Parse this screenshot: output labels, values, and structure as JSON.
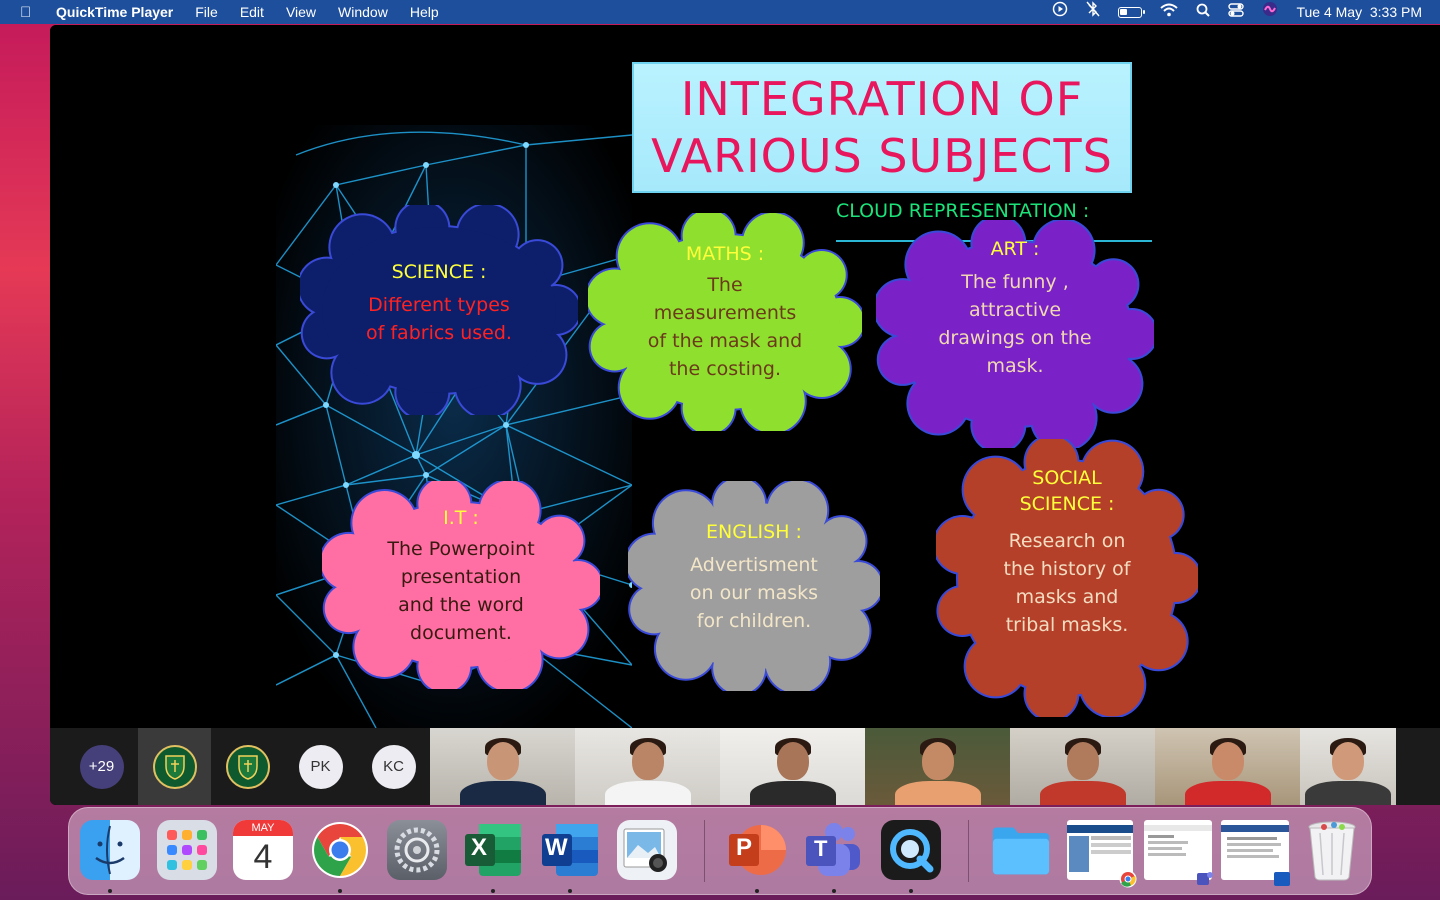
{
  "menubar": {
    "app_name": "QuickTime Player",
    "menus": [
      "File",
      "Edit",
      "View",
      "Window",
      "Help"
    ],
    "datetime": "Tue 4 May  3:33 PM",
    "battery_level": 0.35
  },
  "slide": {
    "title_line1": "INTEGRATION OF",
    "title_line2": "VARIOUS SUBJECTS",
    "subtitle": "CLOUD REPRESENTATION :",
    "clouds": [
      {
        "heading": "SCIENCE :",
        "body": [
          "Different types",
          "of fabrics used."
        ],
        "fill": "#0d1f6a",
        "text_color": "#ff2222"
      },
      {
        "heading": "MATHS :",
        "body": [
          "The",
          "measurements",
          "of the mask and",
          "the costing."
        ],
        "fill": "#8fdf2e",
        "text_color": "#6b3a1a"
      },
      {
        "heading": "ART :",
        "body": [
          "The funny ,",
          "attractive",
          "drawings on the",
          "mask."
        ],
        "fill": "#7a22c8",
        "text_color": "#f0d8b0"
      },
      {
        "heading": "I.T :",
        "body": [
          "The Powerpoint",
          "presentation",
          "and the word",
          "document."
        ],
        "fill": "#ff6fa3",
        "text_color": "#3a1a10"
      },
      {
        "heading": "ENGLISH :",
        "body": [
          "Advertisment",
          "on our masks",
          "for children."
        ],
        "fill": "#9e9e9e",
        "text_color": "#f3e6c8"
      },
      {
        "heading": "SOCIAL",
        "heading2": "SCIENCE :",
        "body": [
          "Research on",
          "the history of",
          "masks and",
          "tribal masks."
        ],
        "fill": "#b5402a",
        "text_color": "#f3dcc0"
      }
    ]
  },
  "participants": {
    "more_count": "+29",
    "initials": [
      "PK",
      "KC"
    ]
  },
  "dock": {
    "calendar_month": "MAY",
    "calendar_day": "4",
    "apps": [
      "Finder",
      "Launchpad",
      "Calendar",
      "Google Chrome",
      "System Preferences",
      "Microsoft Excel",
      "Microsoft Word",
      "Preview",
      "Microsoft PowerPoint",
      "Microsoft Teams",
      "QuickTime Player",
      "Downloads",
      "Chrome window",
      "Teams window",
      "Word window",
      "Trash"
    ],
    "excel_letter": "X",
    "word_letter": "W",
    "ppt_letter": "P",
    "teams_letter": "T"
  },
  "colors": {
    "menubar": "#1e4f9c",
    "title_text": "#e8175d",
    "subtitle_text": "#1be37a",
    "cloud_heading": "#ffff3a"
  }
}
